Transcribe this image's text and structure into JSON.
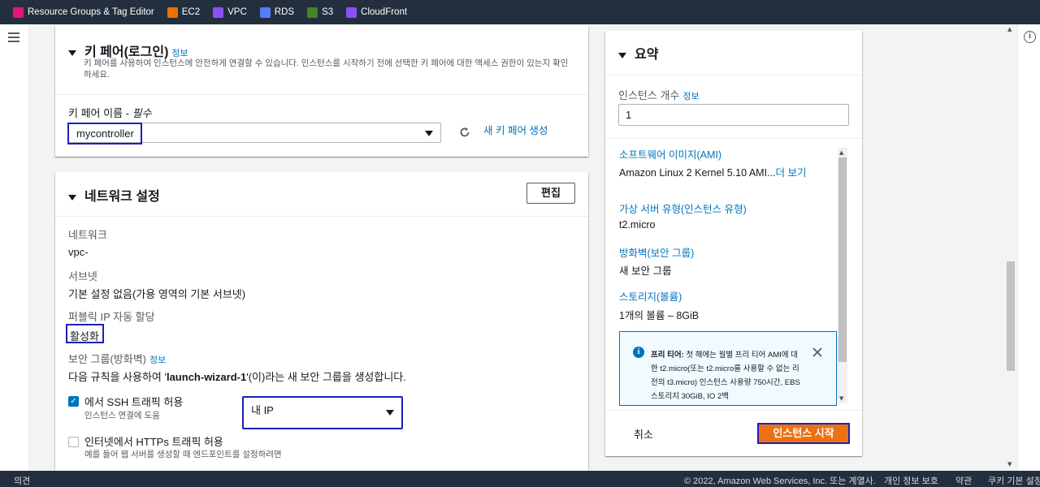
{
  "topbar": {
    "favorites": [
      {
        "label": "Resource Groups & Tag Editor",
        "icon": "resource-groups-icon",
        "color": "#e7157b"
      },
      {
        "label": "EC2",
        "icon": "ec2-icon",
        "color": "#ed7100"
      },
      {
        "label": "VPC",
        "icon": "vpc-icon",
        "color": "#8c4fff"
      },
      {
        "label": "RDS",
        "icon": "rds-icon",
        "color": "#527fff"
      },
      {
        "label": "S3",
        "icon": "s3-icon",
        "color": "#3f8624"
      },
      {
        "label": "CloudFront",
        "icon": "cloudfront-icon",
        "color": "#8c4fff"
      }
    ]
  },
  "keypair": {
    "title": "키 페어(로그인)",
    "info": "정보",
    "description": "키 페어를 사용하여 인스턴스에 안전하게 연결할 수 있습니다. 인스턴스를 시작하기 전에 선택한 키 페어에 대한 액세스 권한이 있는지 확인하세요.",
    "field_label": "키 페어 이름 - ",
    "field_required": "필수",
    "selected": "mycontroller",
    "create_link": "새 키 페어 생성"
  },
  "network": {
    "title": "네트워크 설정",
    "edit_button": "편집",
    "network_label": "네트워크",
    "network_value": "vpc-",
    "subnet_label": "서브넷",
    "subnet_value": "기본 설정 없음(가용 영역의 기본 서브넷)",
    "public_ip_label": "퍼블릭 IP 자동 할당",
    "public_ip_value": "활성화",
    "sg_label": "보안 그룹(방화벽)",
    "sg_info": "정보",
    "sg_desc_prefix": "다음 규칙을 사용하여 '",
    "sg_desc_name": "launch-wizard-1",
    "sg_desc_suffix": "'(이)라는 새 보안 그룹을 생성합니다.",
    "ssh_label": "에서 SSH 트래픽 허용",
    "ssh_sub": "인스턴스 연결에 도움",
    "ssh_checked": true,
    "ssh_source": "내 IP",
    "https_label": "인터넷에서 HTTPs 트래픽 허용",
    "https_sub": "예를 들어 웹 서버를 생성할 때 엔드포인트를 설정하려면",
    "https_checked": false
  },
  "summary": {
    "title": "요약",
    "count_label": "인스턴스 개수",
    "count_info": "정보",
    "count_value": "1",
    "ami_label": "소프트웨어 이미지(AMI)",
    "ami_value": "Amazon Linux 2 Kernel 5.10 AMI...",
    "ami_more": "더 보기",
    "type_label": "가상 서버 유형(인스턴스 유형)",
    "type_value": "t2.micro",
    "fw_label": "방화벽(보안 그룹)",
    "fw_value": "새 보안 그룹",
    "storage_label": "스토리지(볼륨)",
    "storage_value": "1개의 볼륨 – 8GiB",
    "free_tier_title": "프리 티어:",
    "free_tier_text": " 첫 해에는 월별 프리 티어 AMI에 대한 t2.micro(또는 t2.micro를 사용할 수 없는 리전의 t3.micro) 인스턴스 사용량 750시간, EBS 스토리지 30GiB, IO 2백",
    "cancel": "취소",
    "launch": "인스턴스 시작"
  },
  "footer": {
    "feedback": "의견",
    "copyright": "© 2022, Amazon Web Services, Inc. 또는 계열사.",
    "privacy": "개인 정보 보호",
    "terms": "약관",
    "cookies": "쿠키 기본 설정"
  }
}
